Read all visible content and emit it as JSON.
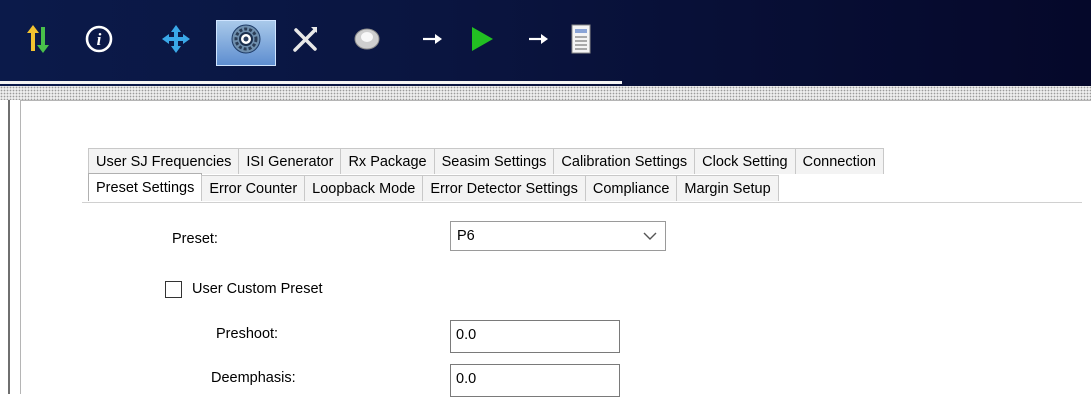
{
  "toolbar": {
    "icons": [
      {
        "name": "sort-arrows-icon"
      },
      {
        "name": "info-icon"
      },
      {
        "name": "move-icon"
      },
      {
        "name": "settings-icon",
        "selected": true
      },
      {
        "name": "tools-icon"
      },
      {
        "name": "disc-icon"
      },
      {
        "name": "arrow-right-icon"
      },
      {
        "name": "run-icon"
      },
      {
        "name": "arrow-right-icon"
      },
      {
        "name": "report-icon"
      }
    ],
    "colors": {
      "background": "#0a1540",
      "play": "#22c022",
      "selected": "#7fa8de"
    }
  },
  "tabs": {
    "row1": [
      "User SJ Frequencies",
      "ISI Generator",
      "Rx Package",
      "Seasim Settings",
      "Calibration Settings",
      "Clock Setting",
      "Connection"
    ],
    "row2": [
      "Preset Settings",
      "Error Counter",
      "Loopback Mode",
      "Error Detector Settings",
      "Compliance",
      "Margin Setup"
    ],
    "active": "Preset Settings"
  },
  "form": {
    "preset_label": "Preset:",
    "preset_value": "P6",
    "user_custom_preset_label": "User Custom Preset",
    "user_custom_preset_checked": false,
    "preshoot_label": "Preshoot:",
    "preshoot_value": "0.0",
    "deemphasis_label": "Deemphasis:",
    "deemphasis_value": "0.0"
  }
}
